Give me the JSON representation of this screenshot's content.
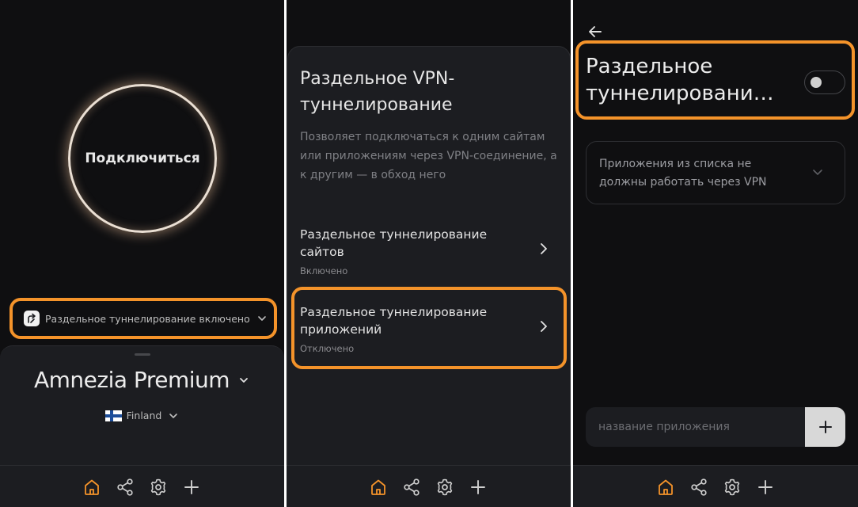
{
  "colors": {
    "accent": "#f4932a",
    "background": "#0f0f11",
    "surface": "#1c1d21",
    "ring": "#eadfd3"
  },
  "screen_main": {
    "connect_button": "Подключиться",
    "split_status": "Раздельное туннелирование включено",
    "plan_name": "Amnezia Premium",
    "server_name": "Finland",
    "server_flag": "flag-finland-icon"
  },
  "screen_split": {
    "title": "Раздельное VPN-туннелирование",
    "description": "Позволяет подключаться к одним сайтам или приложениям через VPN-соединение, а к другим — в обход него",
    "items": [
      {
        "title": "Раздельное туннелирование сайтов",
        "status": "Включено"
      },
      {
        "title": "Раздельное туннелирование приложений",
        "status": "Отключено"
      }
    ]
  },
  "screen_apps": {
    "title_line1": "Раздельное",
    "title_line2": "туннелировани…",
    "toggle_state": "off",
    "mode_label": "Приложения из списка не должны работать через VPN",
    "input_placeholder": "название приложения",
    "add_icon": "plus-icon"
  },
  "navbar": {
    "items": [
      "home-icon",
      "share-icon",
      "settings-icon",
      "plus-icon"
    ],
    "active": "home-icon"
  }
}
